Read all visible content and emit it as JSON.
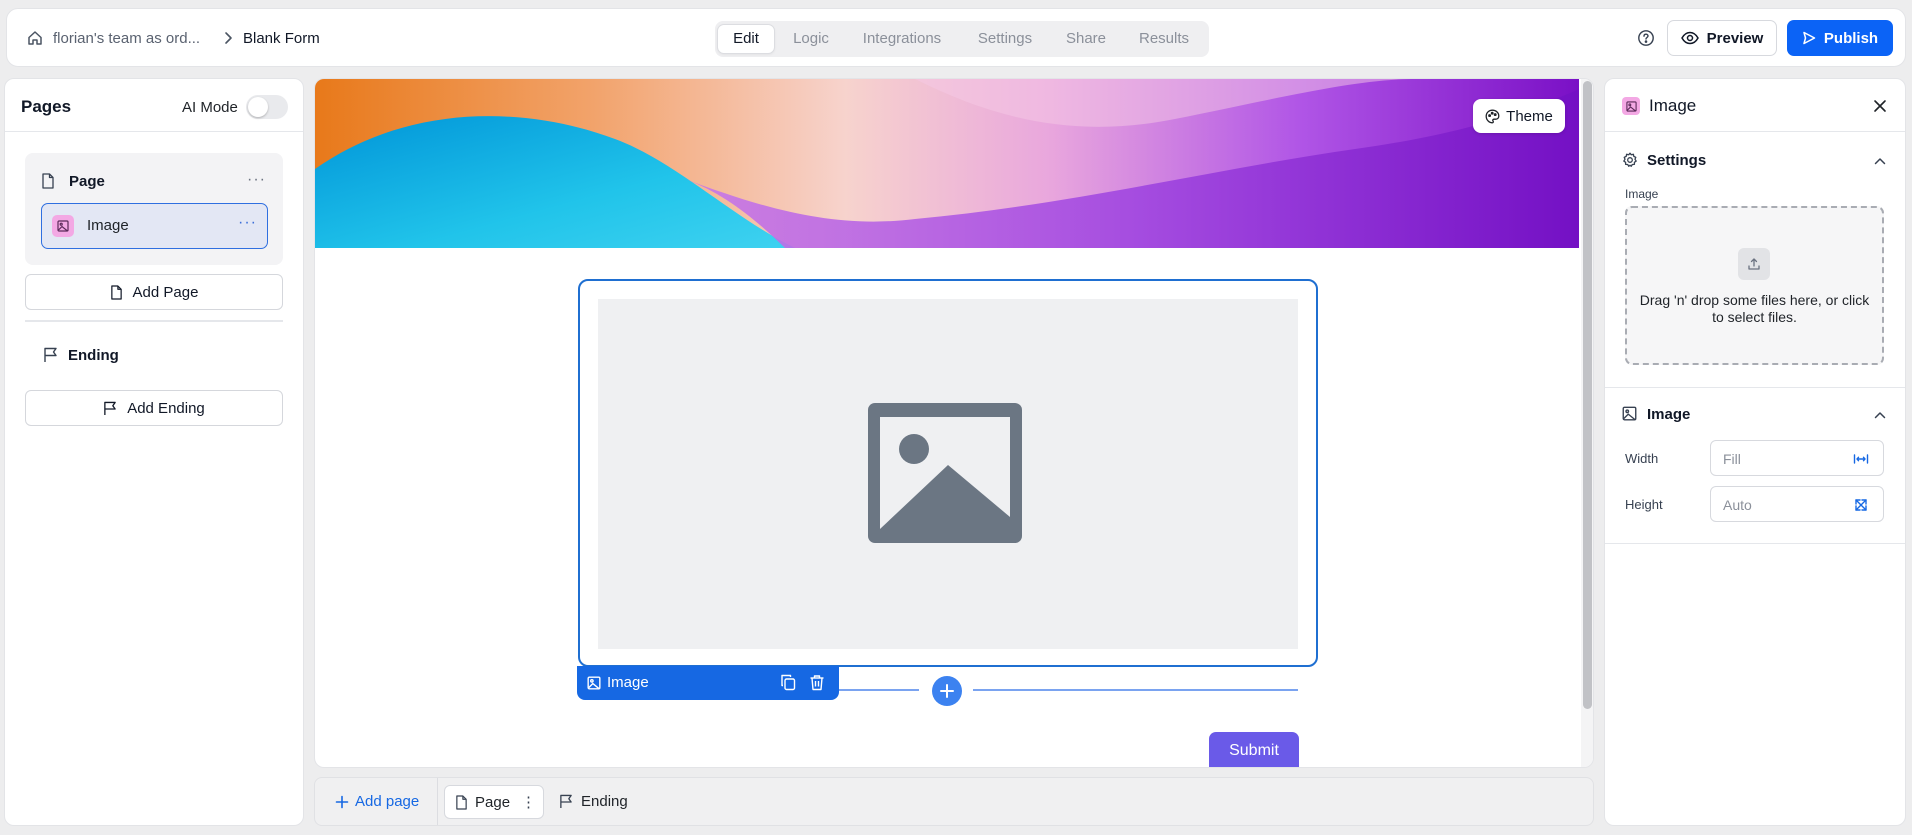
{
  "topbar": {
    "team": "florian's team as ord...",
    "form_title": "Blank Form",
    "tabs": [
      "Edit",
      "Logic",
      "Integrations",
      "Settings",
      "Share",
      "Results"
    ],
    "active_tab": "Edit",
    "preview_label": "Preview",
    "publish_label": "Publish"
  },
  "left": {
    "title": "Pages",
    "ai_mode_label": "AI Mode",
    "ai_mode_on": false,
    "page_label": "Page",
    "image_item_label": "Image",
    "add_page_label": "Add Page",
    "ending_label": "Ending",
    "add_ending_label": "Add Ending"
  },
  "canvas": {
    "theme_label": "Theme",
    "block_tag_label": "Image",
    "submit_label": "Submit"
  },
  "bottom": {
    "add_page_label": "Add page",
    "page_chip_label": "Page",
    "ending_label": "Ending"
  },
  "right": {
    "title": "Image",
    "settings_section": "Settings",
    "image_field_label": "Image",
    "dropzone_text": "Drag 'n' drop some files here, or click to select files.",
    "image_section": "Image",
    "width_label": "Width",
    "width_value": "Fill",
    "height_label": "Height",
    "height_value": "Auto"
  },
  "colors": {
    "accent": "#0b63f6",
    "selection": "#1668e3",
    "submit": "#6a5ae8",
    "image_badge": "#f3a8e4"
  },
  "icons": [
    "home-icon",
    "chevron-right-icon",
    "help-icon",
    "eye-icon",
    "send-icon",
    "file-icon",
    "image-icon",
    "more-icon",
    "flag-icon",
    "palette-icon",
    "copy-icon",
    "trash-icon",
    "plus-icon",
    "close-icon",
    "gear-icon",
    "chevron-up-icon",
    "upload-icon",
    "width-icon",
    "expand-icon"
  ]
}
